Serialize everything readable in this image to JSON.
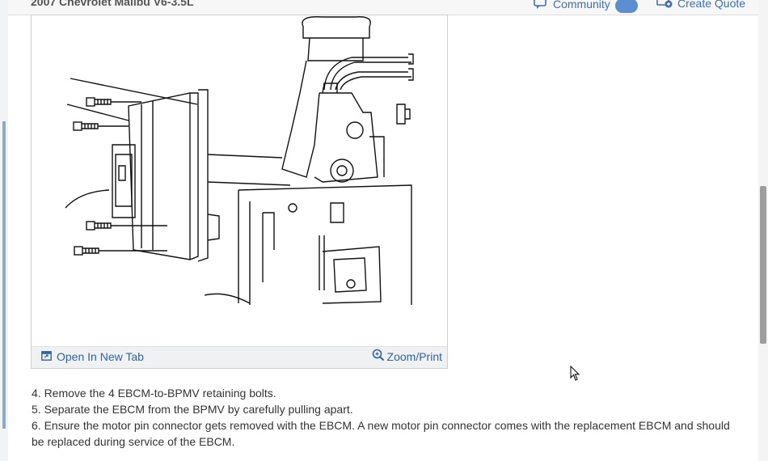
{
  "header": {
    "title": "2007 Chevrolet Malibu V6-3.5L",
    "community_label": "Community",
    "create_quote_label": "Create Quote"
  },
  "figure": {
    "open_tab_label": "Open In New Tab",
    "zoom_label": "Zoom/Print"
  },
  "steps": [
    " 4. Remove the 4 EBCM-to-BPMV retaining bolts.",
    " 5. Separate the EBCM from the BPMV by carefully pulling apart.",
    " 6. Ensure the motor pin connector gets removed with the EBCM. A new motor pin connector comes with the replacement EBCM and should be replaced during service of the EBCM."
  ],
  "colors": {
    "link": "#2d63a8",
    "text": "#333333"
  },
  "icons": [
    "community-icon",
    "create-quote-icon",
    "open-new-tab-icon",
    "zoom-icon",
    "mouse-cursor-icon"
  ]
}
